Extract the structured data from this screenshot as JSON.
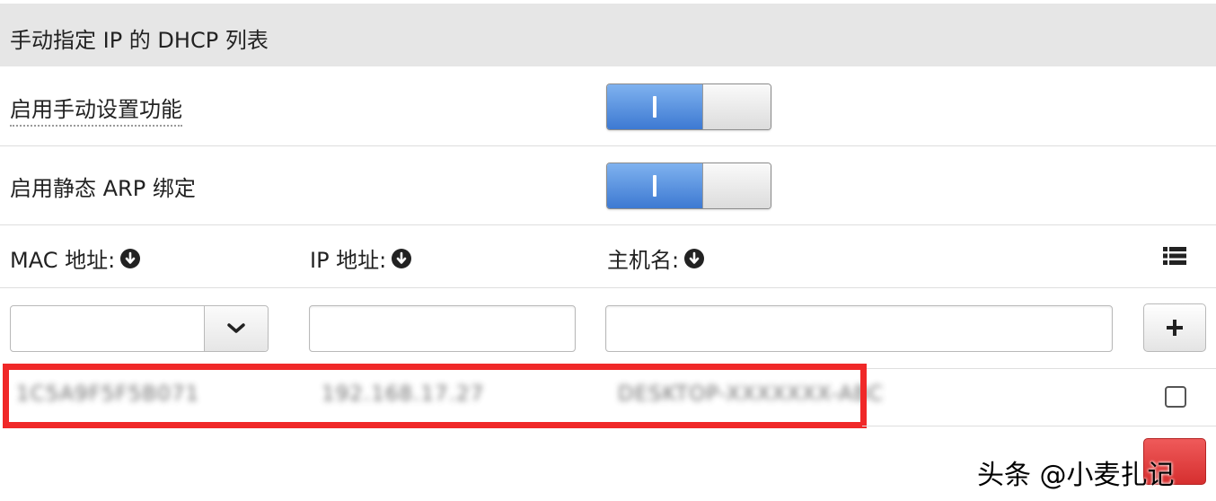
{
  "header": {
    "title": "手动指定 IP 的 DHCP 列表"
  },
  "settings": [
    {
      "label": "启用手动设置功能",
      "enabled": true
    },
    {
      "label": "启用静态 ARP 绑定",
      "enabled": true
    }
  ],
  "columns": {
    "mac": "MAC 地址:",
    "ip": "IP 地址:",
    "hostname": "主机名:"
  },
  "icons": {
    "sort": "sort-down-circle-icon",
    "list": "list-icon",
    "dropdown": "chevron-down-icon",
    "add": "plus-icon"
  },
  "inputs": {
    "mac_value": "",
    "ip_value": "",
    "hostname_value": ""
  },
  "entries": [
    {
      "mac": "1C5A9F5F5B071",
      "ip": "192.168.17.27",
      "hostname": "DESKTOP-XXXXXXX-ABC",
      "checked": false
    }
  ],
  "colors": {
    "toggle_on": "#3d79d2",
    "highlight": "#f02828",
    "delete_button": "#d62f2f"
  },
  "watermark": "头条 @小麦扎记"
}
